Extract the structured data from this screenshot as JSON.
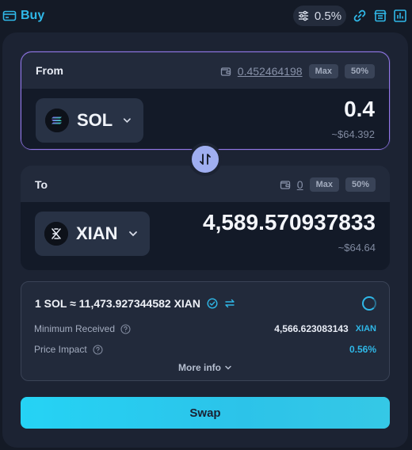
{
  "header": {
    "buy_label": "Buy",
    "slippage": "0.5%",
    "icons": [
      "card-icon",
      "sliders-icon",
      "link-icon",
      "receipt-icon",
      "chart-icon"
    ]
  },
  "from": {
    "label": "From",
    "balance": "0.452464198",
    "max_label": "Max",
    "half_label": "50%",
    "token": "SOL",
    "amount": "0.4",
    "usd": "~$64.392"
  },
  "to": {
    "label": "To",
    "balance": "0",
    "max_label": "Max",
    "half_label": "50%",
    "token": "XIAN",
    "amount": "4,589.570937833",
    "usd": "~$64.64"
  },
  "info": {
    "rate": "1 SOL ≈ 11,473.927344582 XIAN",
    "min_received_label": "Minimum Received",
    "min_received_value": "4,566.623083143",
    "min_received_unit": "XIAN",
    "price_impact_label": "Price Impact",
    "price_impact_value": "0.56%",
    "more_info_label": "More info"
  },
  "swap_button": "Swap",
  "colors": {
    "accent": "#2fb8e8",
    "border_active": "#9277e8",
    "swap_gradient_start": "#25d3f5"
  }
}
